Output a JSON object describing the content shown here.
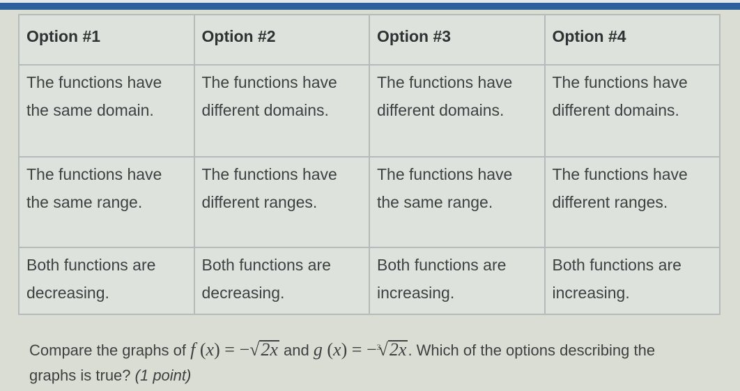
{
  "table": {
    "headers": [
      "Option #1",
      "Option #2",
      "Option #3",
      "Option #4"
    ],
    "rows": [
      {
        "topic": "domain",
        "cells": [
          "The functions have the same domain.",
          "The functions have different domains.",
          "The functions have different domains.",
          "The functions have different domains."
        ]
      },
      {
        "topic": "range",
        "cells": [
          "The functions have the same range.",
          "The functions have different ranges.",
          "The functions have the same range.",
          "The functions have different ranges."
        ]
      },
      {
        "topic": "behavior",
        "cells": [
          "Both functions are decreasing.",
          "Both functions are decreasing.",
          "Both functions are increasing.",
          "Both functions are increasing."
        ]
      }
    ]
  },
  "question": {
    "intro": "Compare the graphs of ",
    "f_name": "f",
    "f_lhs_x": "x",
    "equals": "=",
    "f_sign": "−",
    "f_radicand": "2x",
    "connector": " and ",
    "g_name": "g",
    "g_lhs_x": "x",
    "g_sign": "−",
    "g_index": "3",
    "g_radicand": "2x",
    "outro": ". Which of the options describing the graphs is true? ",
    "points": "(1 point)"
  },
  "colors": {
    "top_bar": "#2f5f9c",
    "table_bg": "#dde2dc",
    "border": "#b4bbb8",
    "text": "#3d4140"
  }
}
